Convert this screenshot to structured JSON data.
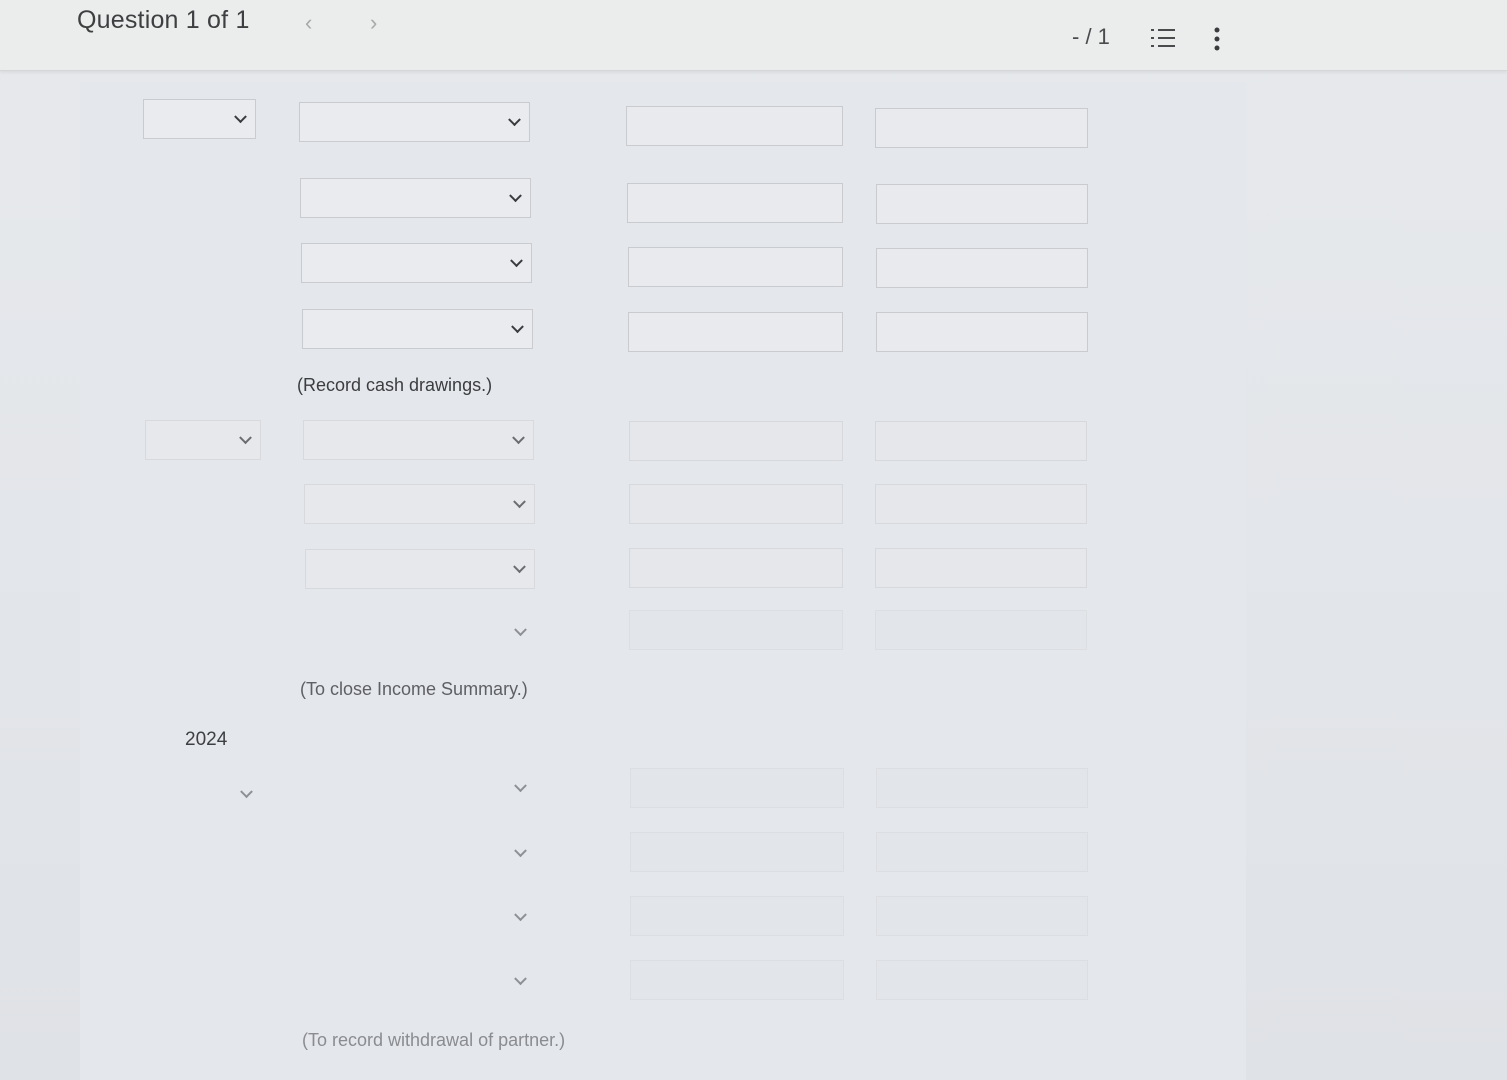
{
  "header": {
    "question_label": "Question 1 of 1",
    "prev_glyph": "‹",
    "next_glyph": "›",
    "page_indicator": "- / 1",
    "list_icon": "list-icon",
    "more_icon": "more-vertical-icon"
  },
  "journal": {
    "entries": [
      {
        "date_select_value": "",
        "rows": [
          {
            "account": "",
            "debit": "",
            "credit": ""
          },
          {
            "account": "",
            "debit": "",
            "credit": ""
          },
          {
            "account": "",
            "debit": "",
            "credit": ""
          },
          {
            "account": "",
            "debit": "",
            "credit": ""
          }
        ],
        "note": "(Record cash drawings.)"
      },
      {
        "date_select_value": "",
        "rows": [
          {
            "account": "",
            "debit": "",
            "credit": ""
          },
          {
            "account": "",
            "debit": "",
            "credit": ""
          },
          {
            "account": "",
            "debit": "",
            "credit": ""
          },
          {
            "account": "",
            "debit": "",
            "credit": ""
          }
        ],
        "note": "(To close Income Summary.)"
      },
      {
        "year_label": "2024",
        "date_select_value": "",
        "rows": [
          {
            "account": "",
            "debit": "",
            "credit": ""
          },
          {
            "account": "",
            "debit": "",
            "credit": ""
          },
          {
            "account": "",
            "debit": "",
            "credit": ""
          },
          {
            "account": "",
            "debit": "",
            "credit": ""
          }
        ],
        "note": "(To record withdrawal of partner.)"
      }
    ]
  }
}
